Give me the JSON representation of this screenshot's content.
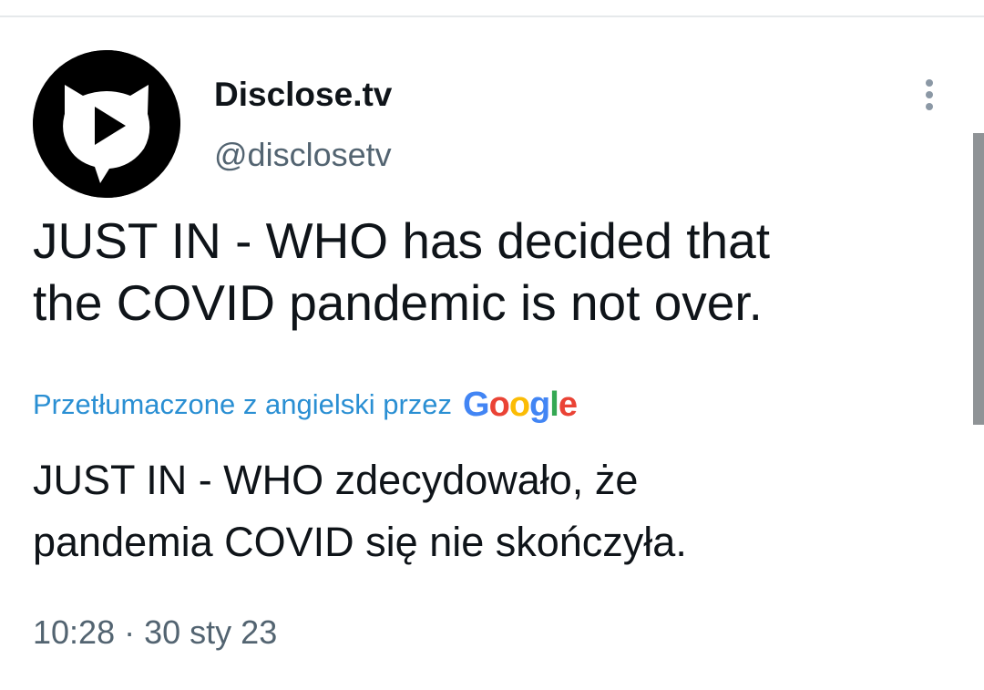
{
  "tweet": {
    "display_name": "Disclose.tv",
    "handle": "@disclosetv",
    "text_lines": [
      "JUST IN - WHO has decided that",
      "the COVID pandemic is not over."
    ],
    "translation_label": "Przetłumaczone z angielski przez",
    "translation_provider": "Google",
    "translation_lines": [
      "JUST IN - WHO zdecydowało, że",
      "pandemia COVID się nie skończyła."
    ],
    "time": "10:28",
    "separator": "·",
    "date": "30 sty 23"
  },
  "icons": {
    "avatar": "disclose-tv-logo",
    "more": "more-options-icon"
  },
  "colors": {
    "primary_text": "#0f1419",
    "secondary_text": "#536471",
    "link": "#2a8fd3",
    "google_blue": "#4285F4",
    "google_red": "#EA4335",
    "google_yellow": "#FBBC05",
    "google_green": "#34A853"
  }
}
